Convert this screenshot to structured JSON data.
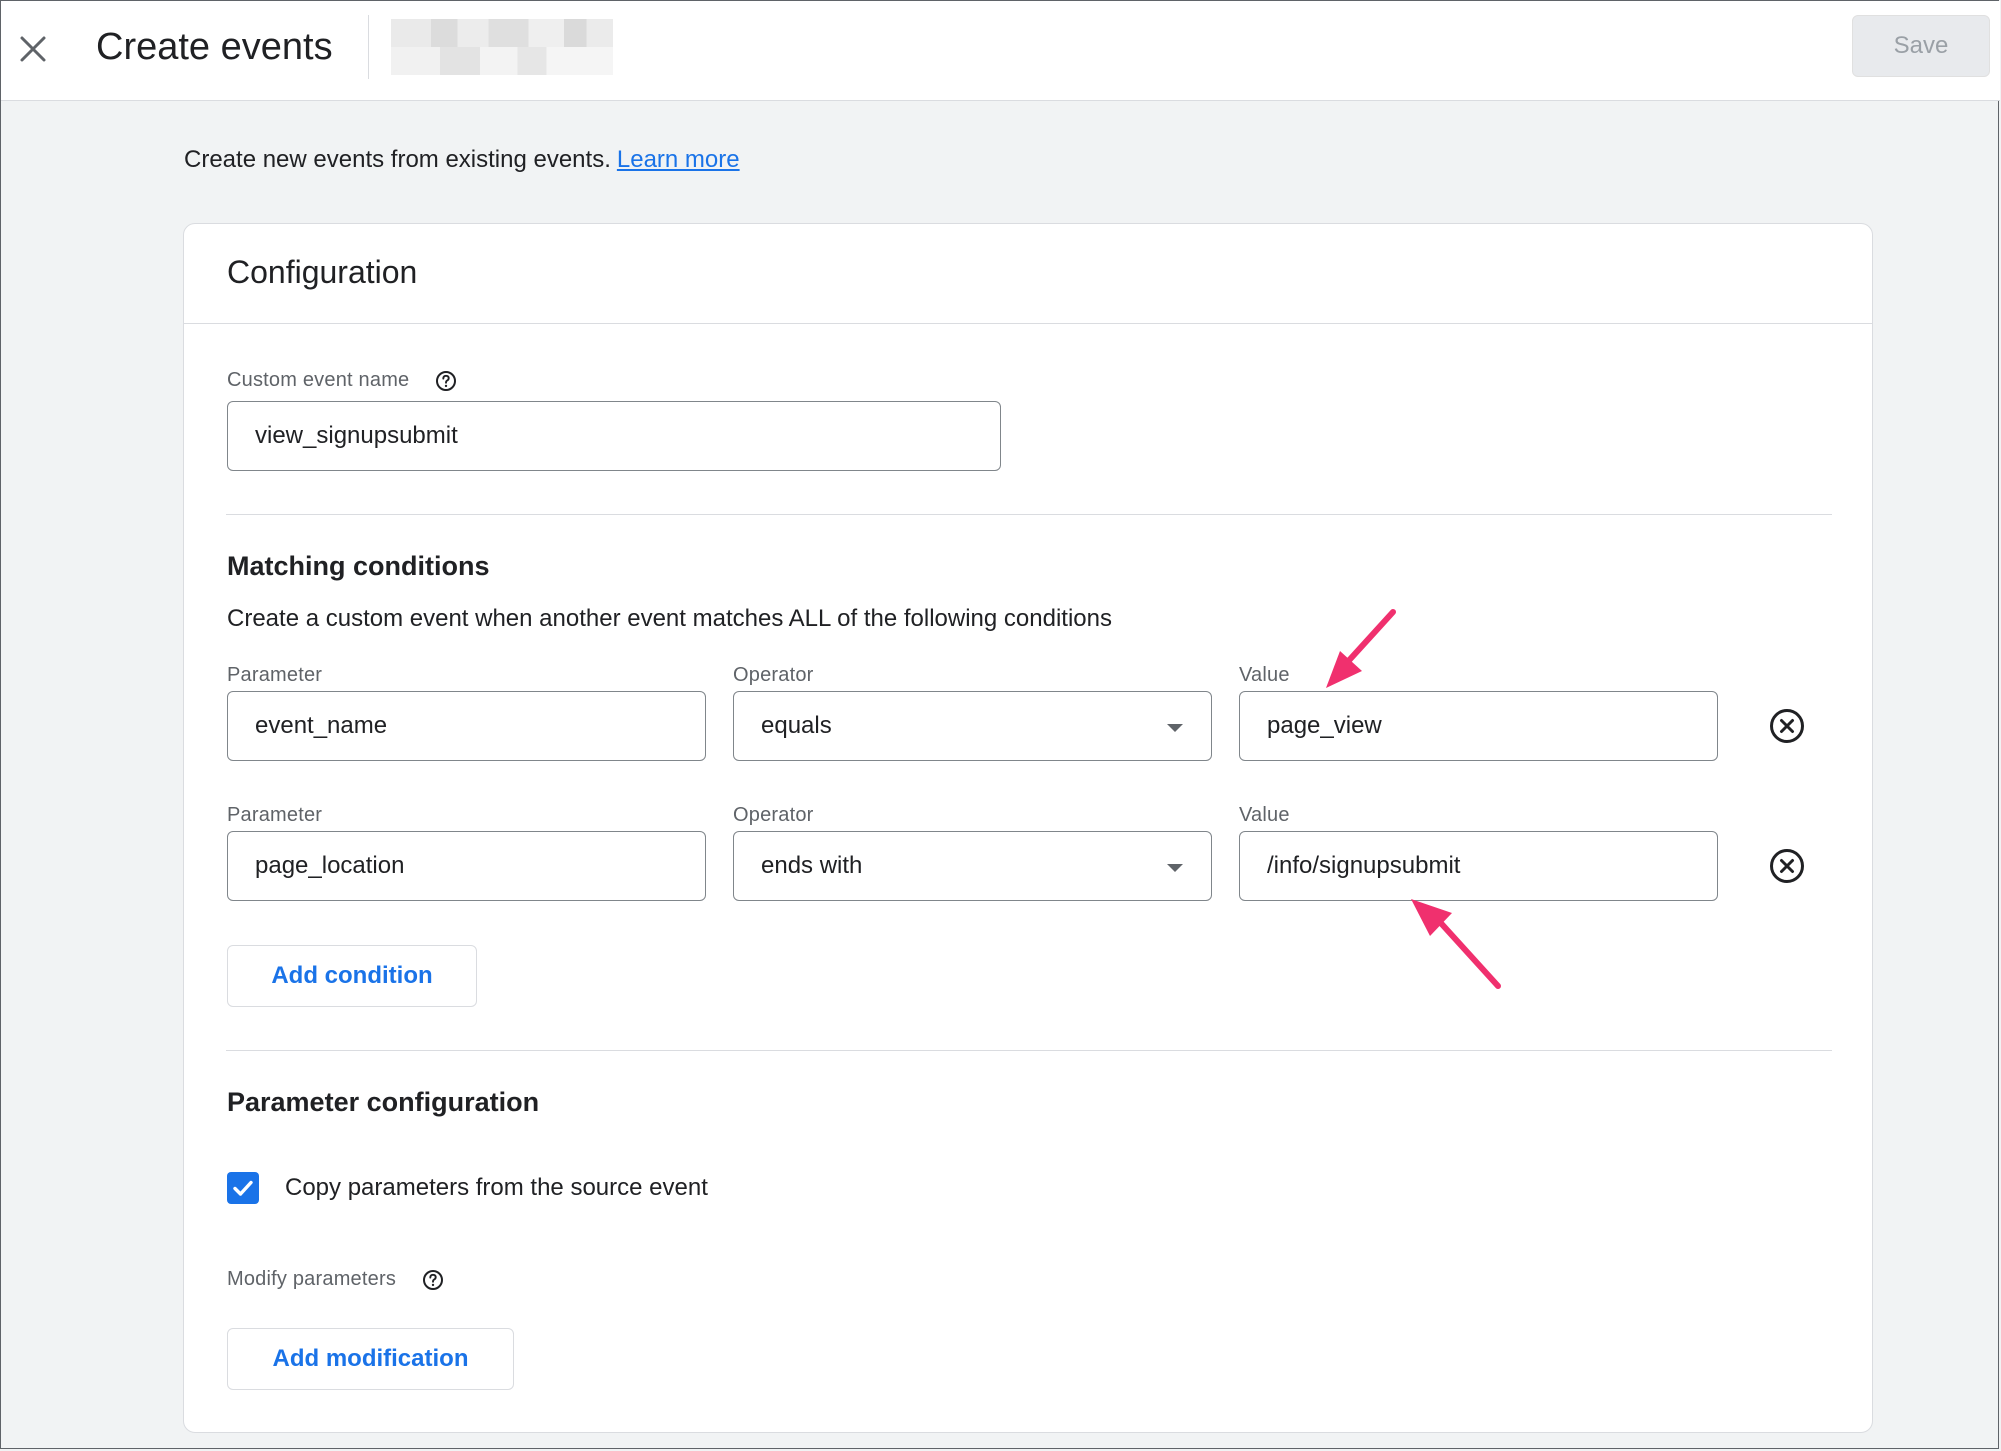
{
  "header": {
    "title": "Create events",
    "save_label": "Save"
  },
  "intro": {
    "text": "Create new events from existing events.",
    "link_label": "Learn more"
  },
  "card": {
    "title": "Configuration",
    "custom_event_name": {
      "label": "Custom event name",
      "value": "view_signupsubmit"
    },
    "matching_conditions": {
      "title": "Matching conditions",
      "description": "Create a custom event when another event matches ALL of the following conditions",
      "rows": [
        {
          "parameter_label": "Parameter",
          "parameter_value": "event_name",
          "operator_label": "Operator",
          "operator_value": "equals",
          "value_label": "Value",
          "value_value": "page_view"
        },
        {
          "parameter_label": "Parameter",
          "parameter_value": "page_location",
          "operator_label": "Operator",
          "operator_value": "ends with",
          "value_label": "Value",
          "value_value": "/info/signupsubmit"
        }
      ],
      "add_condition_label": "Add condition"
    },
    "parameter_configuration": {
      "title": "Parameter configuration",
      "copy_checkbox_label": "Copy parameters from the source event",
      "copy_checked": true,
      "modify_label": "Modify parameters",
      "add_modification_label": "Add modification"
    }
  },
  "colors": {
    "accent": "#1a73e8",
    "annotation_arrow": "#f0306e",
    "page_background": "#f1f3f4"
  },
  "icons": [
    "close-icon",
    "help-icon",
    "dropdown-arrow-icon",
    "remove-circle-icon",
    "checkmark-icon"
  ]
}
